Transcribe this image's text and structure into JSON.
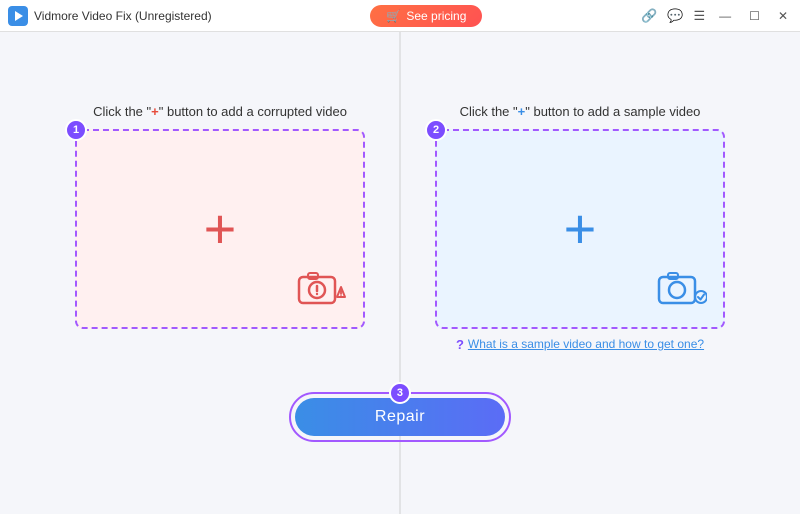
{
  "titlebar": {
    "app_name": "Vidmore Video Fix (Unregistered)",
    "see_pricing_label": "See pricing",
    "icons": {
      "link": "🔗",
      "chat": "💬",
      "menu": "☰",
      "minimize": "—",
      "maximize": "☐",
      "close": "✕"
    }
  },
  "left_panel": {
    "badge": "1",
    "label_prefix": "Click the \"",
    "label_plus": "+",
    "label_suffix": "\" button to add a corrupted video",
    "plus_char": "+"
  },
  "right_panel": {
    "badge": "2",
    "label_prefix": "Click the \"",
    "label_plus": "+",
    "label_suffix": "\" button to add a sample video",
    "plus_char": "+",
    "help_q": "?",
    "help_link": "What is a sample video and how to get one?"
  },
  "repair_section": {
    "badge": "3",
    "button_label": "Repair"
  }
}
